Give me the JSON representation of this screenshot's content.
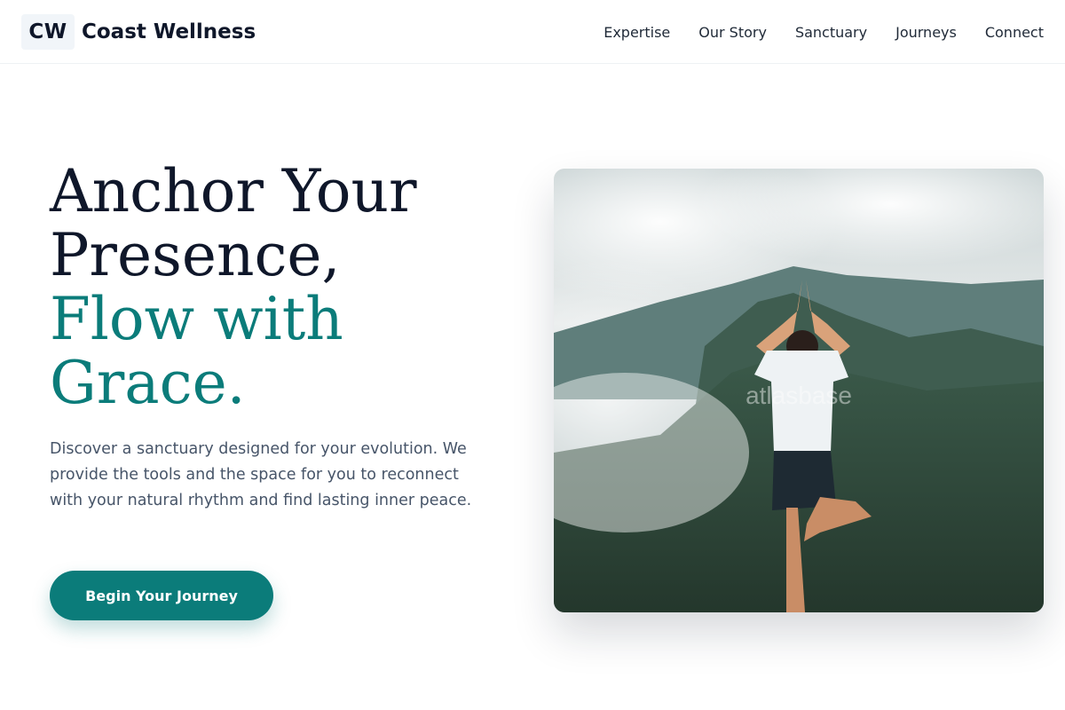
{
  "brand": {
    "logo_text": "CW",
    "name": "Coast Wellness"
  },
  "nav": [
    {
      "label": "Expertise"
    },
    {
      "label": "Our Story"
    },
    {
      "label": "Sanctuary"
    },
    {
      "label": "Journeys"
    },
    {
      "label": "Connect"
    }
  ],
  "hero": {
    "headline_lines": [
      "Anchor Your",
      "Presence,"
    ],
    "headline_accent_lines": [
      "Flow with",
      "Grace."
    ],
    "subtext": "Discover a sanctuary designed for your evolution. We provide the tools and the space for you to reconnect with your natural rhythm and find lasting inner peace.",
    "cta_label": "Begin Your Journey",
    "image": {
      "subject": "woman-yoga-tree-pose-misty-mountains",
      "watermark": "atlasbase"
    }
  },
  "colors": {
    "accent": "#0b7c7a",
    "heading": "#0f172a",
    "body_text": "#475569",
    "nav_text": "#1f2937"
  }
}
